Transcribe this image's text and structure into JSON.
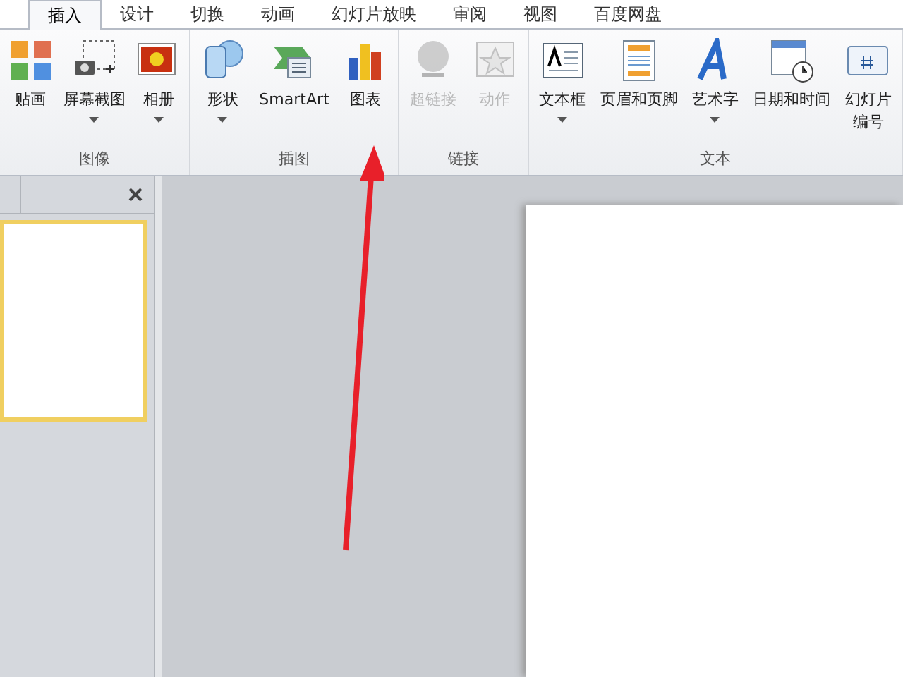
{
  "tabs": [
    {
      "label": "插入",
      "selected": true
    },
    {
      "label": "设计",
      "selected": false
    },
    {
      "label": "切换",
      "selected": false
    },
    {
      "label": "动画",
      "selected": false
    },
    {
      "label": "幻灯片放映",
      "selected": false
    },
    {
      "label": "审阅",
      "selected": false
    },
    {
      "label": "视图",
      "selected": false
    },
    {
      "label": "百度网盘",
      "selected": false
    }
  ],
  "ribbon_groups": [
    {
      "label": "图像",
      "buttons": [
        {
          "label": "贴画",
          "disabled": false,
          "dropdown": false
        },
        {
          "label": "屏幕截图",
          "disabled": false,
          "dropdown": true
        },
        {
          "label": "相册",
          "disabled": false,
          "dropdown": true
        }
      ]
    },
    {
      "label": "插图",
      "buttons": [
        {
          "label": "形状",
          "disabled": false,
          "dropdown": true
        },
        {
          "label": "SmartArt",
          "disabled": false,
          "dropdown": false
        },
        {
          "label": "图表",
          "disabled": false,
          "dropdown": false
        }
      ]
    },
    {
      "label": "链接",
      "buttons": [
        {
          "label": "超链接",
          "disabled": true,
          "dropdown": false
        },
        {
          "label": "动作",
          "disabled": true,
          "dropdown": false
        }
      ]
    },
    {
      "label": "文本",
      "buttons": [
        {
          "label": "文本框",
          "disabled": false,
          "dropdown": true
        },
        {
          "label": "页眉和页脚",
          "disabled": false,
          "dropdown": false
        },
        {
          "label": "艺术字",
          "disabled": false,
          "dropdown": true
        },
        {
          "label": "日期和时间",
          "disabled": false,
          "dropdown": false
        },
        {
          "label": "幻灯片",
          "label_line_2": "编号",
          "disabled": false,
          "dropdown": false
        }
      ]
    }
  ],
  "slides_panel": {
    "thumbnails": [
      {
        "selected": true
      }
    ]
  }
}
